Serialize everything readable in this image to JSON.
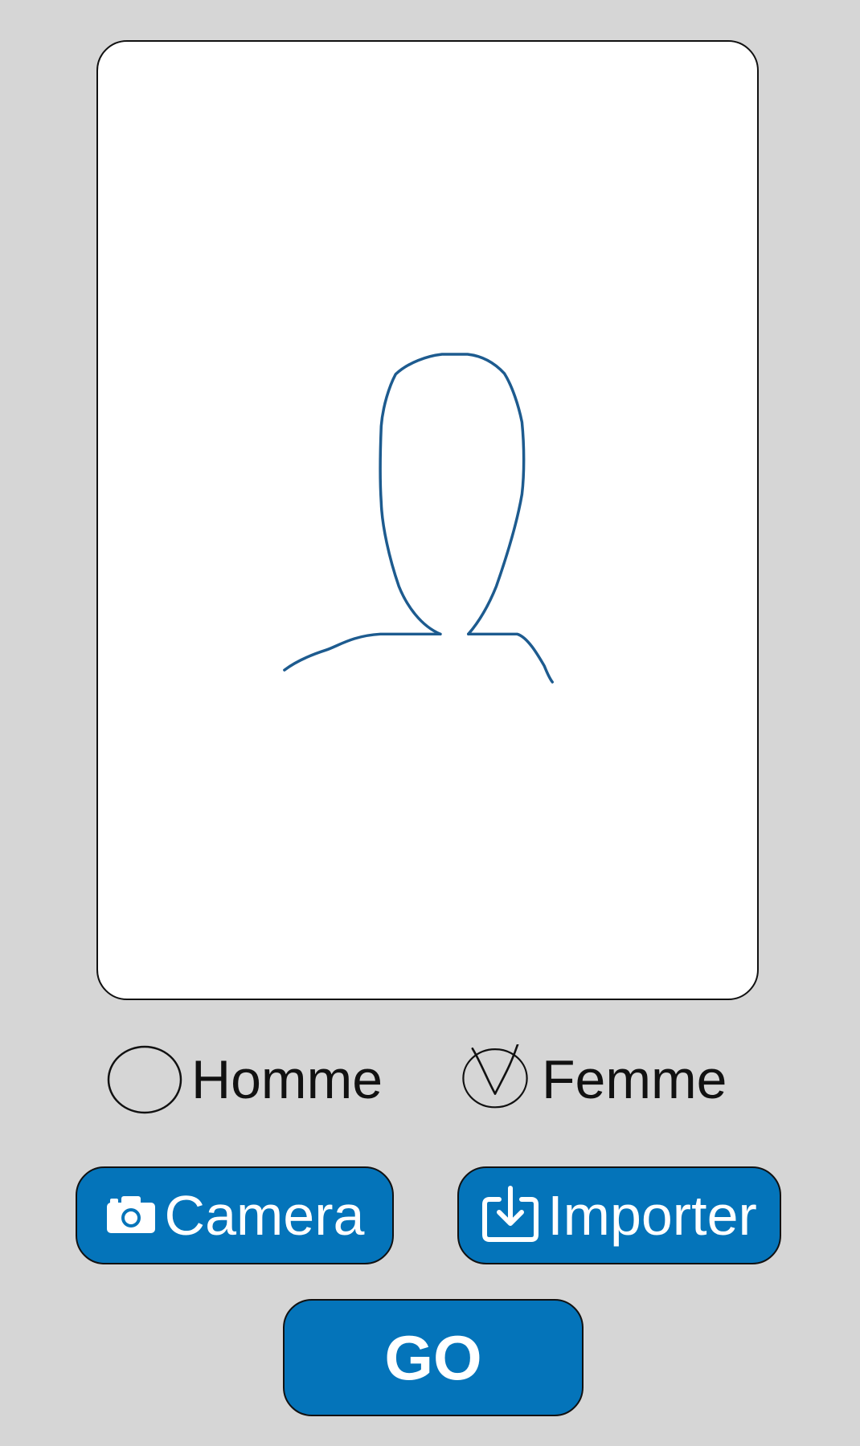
{
  "gender": {
    "options": [
      {
        "label": "Homme",
        "checked": false
      },
      {
        "label": "Femme",
        "checked": true
      }
    ]
  },
  "actions": {
    "camera_label": "Camera",
    "import_label": "Importer",
    "go_label": "GO"
  },
  "colors": {
    "background": "#d6d6d6",
    "accent": "#0474ba",
    "silhouette": "#1d5b8f"
  },
  "icons": {
    "camera": "camera-icon",
    "import": "download-tray-icon",
    "placeholder": "person-silhouette-icon"
  }
}
